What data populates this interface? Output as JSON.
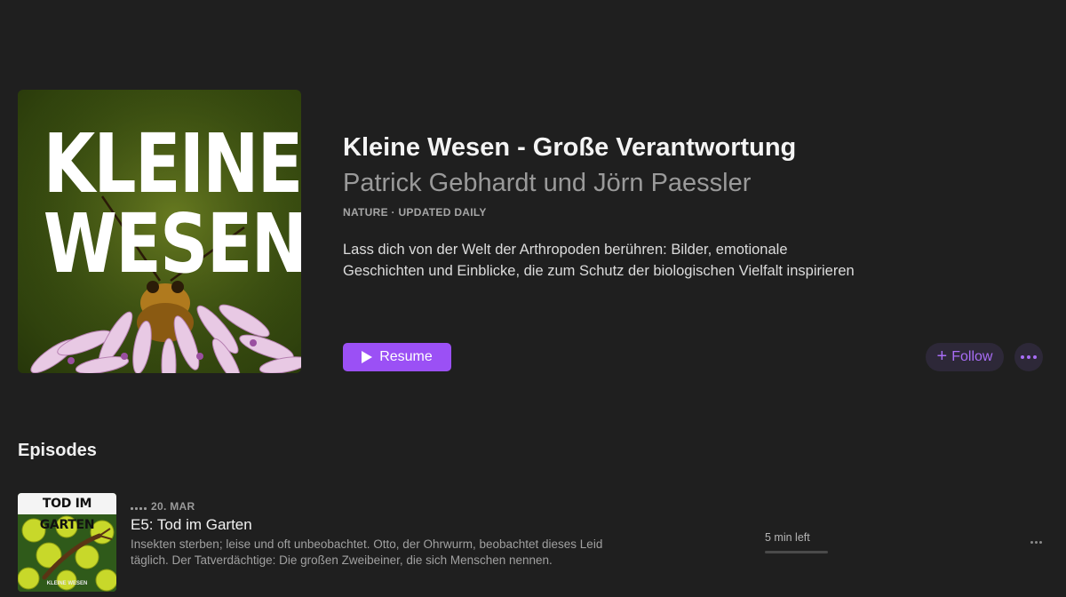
{
  "podcast": {
    "artwork": {
      "line1": "KLEINE",
      "line2": "WESEN"
    },
    "title": "Kleine Wesen - Große Verantwortung",
    "author": "Patrick Gebhardt und Jörn Paessler",
    "meta": "NATURE · UPDATED DAILY",
    "description": "Lass dich von der Welt der Arthropoden berühren: Bilder, emotionale Geschichten und Einblicke, die zum Schutz der biologischen Vielfalt inspirieren"
  },
  "actions": {
    "resume_label": "Resume",
    "follow_label": "Follow",
    "accent_color": "#9b50f5"
  },
  "episodes": {
    "heading": "Episodes",
    "items": [
      {
        "artwork_label": "TOD IM GARTEN",
        "artwork_footer": "KLEINE WESEN",
        "date": "20. MAR",
        "title": "E5: Tod im Garten",
        "description": "Insekten sterben; leise und oft unbeobachtet. Otto, der Ohrwurm, beobachtet dieses Leid täglich. Der Tatverdächtige: Die großen Zweibeiner, die sich Menschen nennen.",
        "time_left": "5 min left",
        "progress": 0.0
      }
    ]
  },
  "icons": {
    "resume": "play-icon",
    "follow": "plus-icon",
    "more": "ellipsis-icon"
  }
}
